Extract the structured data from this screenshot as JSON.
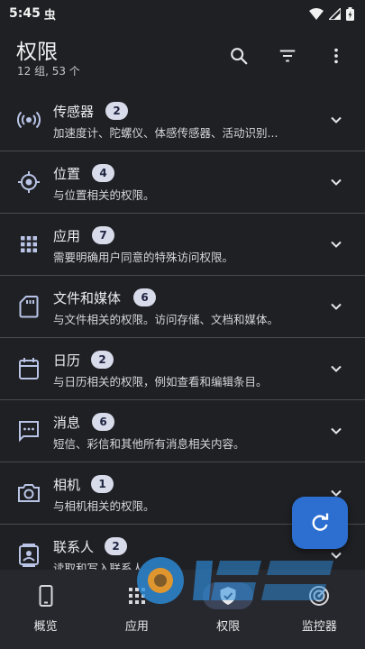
{
  "status": {
    "time": "5:45",
    "notif": "虫"
  },
  "header": {
    "title": "权限",
    "subtitle": "12 组, 53 个"
  },
  "groups": [
    {
      "icon": "sensors-icon",
      "name": "传感器",
      "count": "2",
      "desc": "加速度计、陀螺仪、体感传感器、活动识别..."
    },
    {
      "icon": "location-icon",
      "name": "位置",
      "count": "4",
      "desc": "与位置相关的权限。"
    },
    {
      "icon": "apps-grid-icon",
      "name": "应用",
      "count": "7",
      "desc": "需要明确用户同意的特殊访问权限。"
    },
    {
      "icon": "sd-card-icon",
      "name": "文件和媒体",
      "count": "6",
      "desc": "与文件相关的权限。访问存储、文档和媒体。"
    },
    {
      "icon": "calendar-icon",
      "name": "日历",
      "count": "2",
      "desc": "与日历相关的权限，例如查看和编辑条目。"
    },
    {
      "icon": "message-icon",
      "name": "消息",
      "count": "6",
      "desc": "短信、彩信和其他所有消息相关内容。"
    },
    {
      "icon": "camera-icon",
      "name": "相机",
      "count": "1",
      "desc": "与相机相关的权限。"
    },
    {
      "icon": "contacts-icon",
      "name": "联系人",
      "count": "2",
      "desc": "读取和写入联系人。"
    }
  ],
  "nav": [
    {
      "icon": "phone-icon",
      "label": "概览"
    },
    {
      "icon": "apps-icon",
      "label": "应用"
    },
    {
      "icon": "shield-icon",
      "label": "权限",
      "active": true
    },
    {
      "icon": "radar-icon",
      "label": "监控器"
    }
  ],
  "colors": {
    "background": "#1f2024",
    "badge": "#d8dbe9",
    "fab": "#2c6fd1",
    "active_nav": "#3b4458"
  }
}
